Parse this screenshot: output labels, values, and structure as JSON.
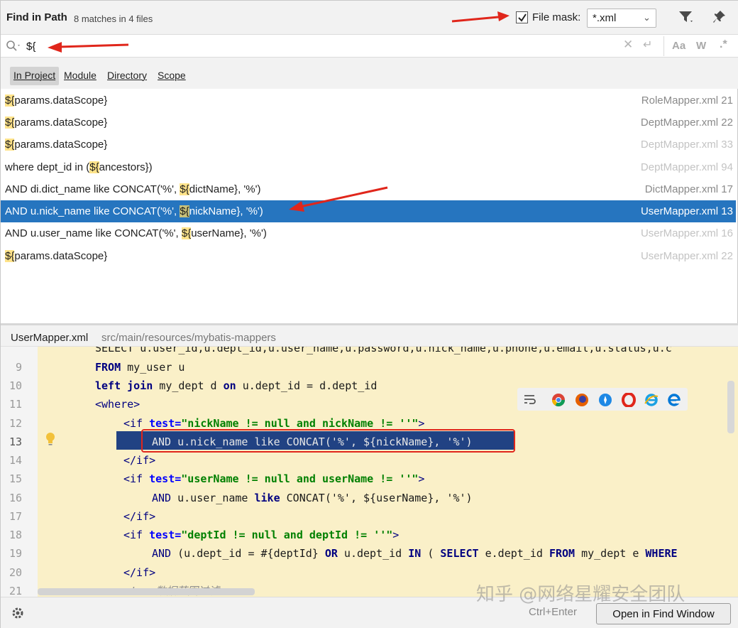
{
  "header": {
    "title": "Find in Path",
    "match_count": "8 matches in 4 files",
    "file_mask_label": "File mask:",
    "file_mask_checked": true,
    "file_mask_value": "*.xml",
    "filter_icon": "filter-icon",
    "pin_icon": "pin-icon"
  },
  "search": {
    "query": "${",
    "case_label": "Aa",
    "words_label": "W",
    "regex_label": ".*"
  },
  "scopes": [
    {
      "label": "In Project",
      "active": true
    },
    {
      "label": "Module",
      "active": false
    },
    {
      "label": "Directory",
      "active": false
    },
    {
      "label": "Scope",
      "active": false
    }
  ],
  "results": [
    {
      "pre": "",
      "match": "${",
      "post": "params.dataScope}",
      "file": "RoleMapper.xml 21",
      "dim": false,
      "selected": false
    },
    {
      "pre": "",
      "match": "${",
      "post": "params.dataScope}",
      "file": "DeptMapper.xml 22",
      "dim": false,
      "selected": false
    },
    {
      "pre": "",
      "match": "${",
      "post": "params.dataScope}",
      "file": "DeptMapper.xml 33",
      "dim": true,
      "selected": false
    },
    {
      "pre": "where dept_id in (",
      "match": "${",
      "post": "ancestors})",
      "file": "DeptMapper.xml 94",
      "dim": true,
      "selected": false
    },
    {
      "pre": "AND di.dict_name like CONCAT('%', ",
      "match": "${",
      "post": "dictName}, '%')",
      "file": "DictMapper.xml 17",
      "dim": false,
      "selected": false
    },
    {
      "pre": "AND u.nick_name like CONCAT('%', ",
      "match": "${",
      "post": "nickName}, '%')",
      "file": "UserMapper.xml 13",
      "dim": false,
      "selected": true
    },
    {
      "pre": "AND u.user_name like CONCAT('%', ",
      "match": "${",
      "post": "userName}, '%')",
      "file": "UserMapper.xml 16",
      "dim": true,
      "selected": false
    },
    {
      "pre": "",
      "match": "${",
      "post": "params.dataScope}",
      "file": "UserMapper.xml 22",
      "dim": true,
      "selected": false
    }
  ],
  "preview": {
    "file_name": "UserMapper.xml",
    "file_path": "src/main/resources/mybatis-mappers",
    "partial_line": "SELECT u.user_id,u.dept_id,u.user_name,u.password,u.nick_name,u.phone,u.email,u.status,u.c",
    "line_numbers": [
      "9",
      "10",
      "11",
      "12",
      "13",
      "14",
      "15",
      "16",
      "17",
      "18",
      "19",
      "20",
      "21"
    ],
    "current_line": "13",
    "lines": {
      "l9_kw": "FROM",
      "l9_rest": " my_user u",
      "l10_kw1": "left join",
      "l10_a": " my_dept d ",
      "l10_kw2": "on",
      "l10_b": " u.dept_id = d.dept_id",
      "l11": "<where>",
      "l12_tag": "<if ",
      "l12_attr": "test=",
      "l12_str": "\"nickName != null and nickName != ''\"",
      "l12_end": ">",
      "l13": "AND u.nick_name like CONCAT('%', ${nickName}, '%')",
      "l14": "</if>",
      "l15_tag": "<if ",
      "l15_attr": "test=",
      "l15_str": "\"userName != null and userName != ''\"",
      "l15_end": ">",
      "l16_kw": "AND",
      "l16_a": " u.user_name ",
      "l16_kw2": "like",
      "l16_b": " CONCAT('%', ${userName}, '%')",
      "l17": "</if>",
      "l18_tag": "<if ",
      "l18_attr": "test=",
      "l18_str": "\"deptId != null and deptId != ''\"",
      "l18_end": ">",
      "l19_kw": "AND",
      "l19_a": " (u.dept_id = #{deptId} ",
      "l19_kw2": "OR",
      "l19_b": " u.dept_id ",
      "l19_kw3": "IN",
      "l19_c": " ( ",
      "l19_kw4": "SELECT",
      "l19_d": " e.dept_id ",
      "l19_kw5": "FROM",
      "l19_e": " my_dept e ",
      "l19_kw6": "WHERE",
      "l20": "</if>",
      "l21": "<!-- 数据范围过滤 -->"
    }
  },
  "footer": {
    "shortcut_hint": "Ctrl+Enter",
    "open_button": "Open in Find Window"
  },
  "watermark": "知乎 @网络星耀安全团队",
  "colors": {
    "selection": "#2675bf",
    "match_highlight": "#ffe38a",
    "annotation_red": "#e0261b"
  }
}
